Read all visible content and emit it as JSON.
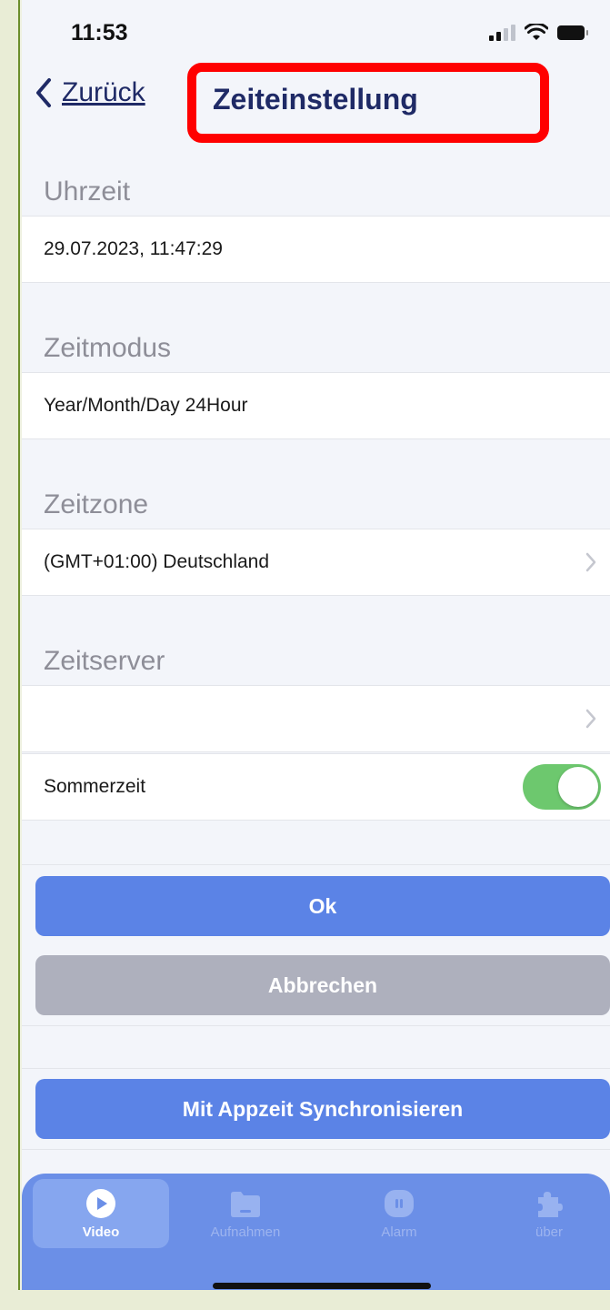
{
  "status_bar": {
    "time": "11:53"
  },
  "nav": {
    "back_label": "Zurück",
    "title": "Zeiteinstellung"
  },
  "sections": {
    "uhrzeit": {
      "header": "Uhrzeit",
      "value": "29.07.2023, 11:47:29"
    },
    "zeitmodus": {
      "header": "Zeitmodus",
      "value": "Year/Month/Day 24Hour"
    },
    "zeitzone": {
      "header": "Zeitzone",
      "value": "(GMT+01:00) Deutschland"
    },
    "zeitserver": {
      "header": "Zeitserver",
      "value": ""
    },
    "sommerzeit": {
      "label": "Sommerzeit",
      "enabled": true
    }
  },
  "buttons": {
    "ok": "Ok",
    "cancel": "Abbrechen",
    "sync": "Mit Appzeit Synchronisieren"
  },
  "tabs": [
    {
      "label": "Video",
      "icon": "play-icon",
      "active": true
    },
    {
      "label": "Aufnahmen",
      "icon": "folder-icon",
      "active": false
    },
    {
      "label": "Alarm",
      "icon": "alarm-icon",
      "active": false
    },
    {
      "label": "über",
      "icon": "puzzle-icon",
      "active": false
    }
  ],
  "colors": {
    "accent": "#5b83e6",
    "tab_bar": "#6b8fe7",
    "toggle_on": "#6dc86e",
    "highlight": "#ff0000",
    "title": "#1f2a66"
  }
}
